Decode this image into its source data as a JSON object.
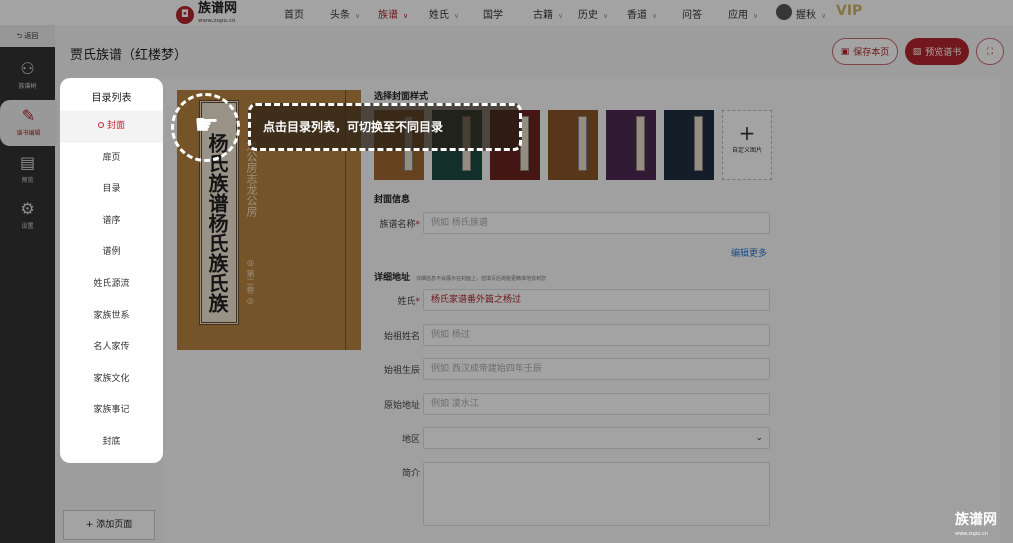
{
  "topnav": {
    "logo_text": "族谱网",
    "logo_sub": "www.zupu.cn",
    "items": [
      {
        "label": "首页",
        "dropdown": false
      },
      {
        "label": "头条",
        "dropdown": true
      },
      {
        "label": "族谱",
        "dropdown": true,
        "active": true
      },
      {
        "label": "姓氏",
        "dropdown": true
      },
      {
        "label": "国学",
        "dropdown": false
      },
      {
        "label": "古籍",
        "dropdown": true
      },
      {
        "label": "历史",
        "dropdown": true
      },
      {
        "label": "香道",
        "dropdown": true
      },
      {
        "label": "问答",
        "dropdown": false
      },
      {
        "label": "应用",
        "dropdown": true
      }
    ],
    "user": "握秋",
    "vip": "VIP"
  },
  "sidebar": {
    "back": "返回",
    "items": [
      {
        "label": "族谱树",
        "icon": "tree-icon"
      },
      {
        "label": "谱书编辑",
        "icon": "edit-icon",
        "active": true
      },
      {
        "label": "预览",
        "icon": "preview-icon"
      },
      {
        "label": "设置",
        "icon": "gear-icon"
      }
    ]
  },
  "header": {
    "title": "贾氏族谱（红楼梦）",
    "save": "保存本页",
    "preview": "预览谱书"
  },
  "menu": {
    "title": "目录列表",
    "items": [
      "封面",
      "扉页",
      "目录",
      "谱序",
      "谱例",
      "姓氏源流",
      "家族世系",
      "名人家传",
      "家族文化",
      "家族事记",
      "封底"
    ],
    "active": "封面",
    "add_page": "添加页面"
  },
  "cover": {
    "title": "杨氏族谱杨氏族氏族",
    "subtitle": "龙公房志龙公房",
    "volume": "◎ 第二卷 ◎"
  },
  "cover_styles": {
    "label": "选择封面样式",
    "colors": [
      "#a06a30",
      "#1f4a40",
      "#6b2420",
      "#8a5528",
      "#4b2a52",
      "#1e3040"
    ],
    "custom": "自定义图片"
  },
  "form": {
    "section_cover": "封面信息",
    "name_label": "族谱名称",
    "name_placeholder": "例如 杨氏族谱",
    "edit_more": "编辑更多",
    "section_address": "详细地址",
    "address_hint": "详细信息不会展示在封面上，但填写后将能更精准地找到您",
    "surname_label": "姓氏",
    "surname_value": "杨氏家谱番外篇之杨过",
    "ancestor_label": "始祖姓名",
    "ancestor_placeholder": "例如 杨过",
    "birth_label": "始祖生辰",
    "birth_placeholder": "例如 西汉成帝建始四年壬辰",
    "origin_label": "原始地址",
    "origin_placeholder": "例如 凌水江",
    "region_label": "地区",
    "intro_label": "简介"
  },
  "tip": {
    "text": "点击目录列表，可切换至不同目录"
  },
  "watermark": {
    "text": "族谱网",
    "url": "www.zupu.cn"
  },
  "accent": "#b3262c"
}
